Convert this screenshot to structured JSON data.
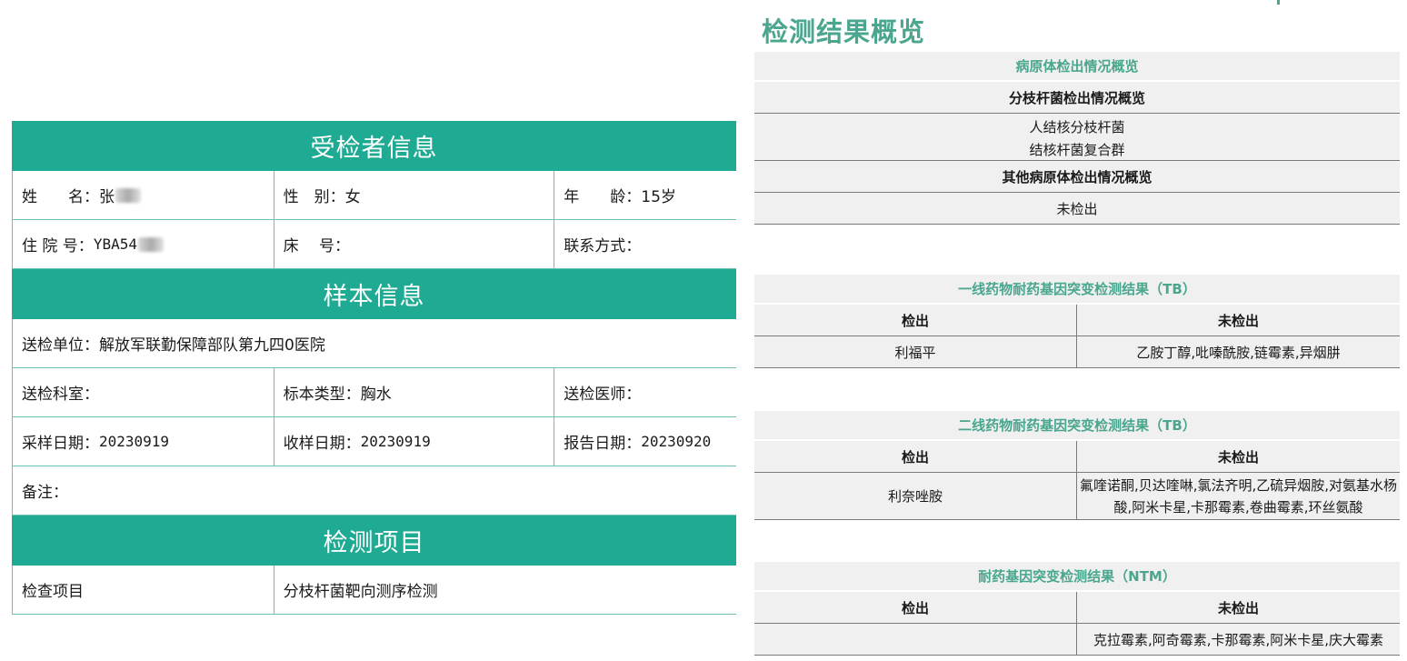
{
  "left": {
    "section_patient": "受检者信息",
    "name_label": "姓　　名：",
    "name_value": "张",
    "gender_label": "性　别：",
    "gender_value": "女",
    "age_label": "年　　龄：",
    "age_value": "15岁",
    "inpatient_label": "住 院 号：",
    "inpatient_value": "YBA54",
    "bed_label": "床　 号：",
    "contact_label": "联系方式：",
    "section_sample": "样本信息",
    "unit_label": "送检单位：",
    "unit_value": "解放军联勤保障部队第九四0医院",
    "dept_label": "送检科室：",
    "sample_type_label": "标本类型：",
    "sample_type_value": "胸水",
    "doctor_label": "送检医师：",
    "collect_label": "采样日期：",
    "collect_value": "20230919",
    "receive_label": "收样日期：",
    "receive_value": "20230919",
    "report_label": "报告日期：",
    "report_value": "20230920",
    "remark_label": "备注：",
    "section_test": "检测项目",
    "test_item_label": "检查项目",
    "test_item_value": "分枝杆菌靶向测序检测"
  },
  "right": {
    "title": "检测结果概览",
    "pathogen": {
      "header": "病原体检出情况概览",
      "myco_header": "分枝杆菌检出情况概览",
      "myco_items": [
        "人结核分枝杆菌",
        "结核杆菌复合群"
      ],
      "other_header": "其他病原体检出情况概览",
      "other_value": "未检出"
    },
    "first_line": {
      "header": "一线药物耐药基因突变检测结果（TB）",
      "col_detected": "检出",
      "col_not_detected": "未检出",
      "detected": "利福平",
      "not_detected": "乙胺丁醇,吡嗪酰胺,链霉素,异烟肼"
    },
    "second_line": {
      "header": "二线药物耐药基因突变检测结果（TB）",
      "col_detected": "检出",
      "col_not_detected": "未检出",
      "detected": "利奈唑胺",
      "not_detected_1": "氟喹诺酮,贝达喹啉,氯法齐明,乙硫异烟胺,对氨基水杨",
      "not_detected_2": "酸,阿米卡星,卡那霉素,卷曲霉素,环丝氨酸"
    },
    "ntm": {
      "header": "耐药基因突变检测结果（NTM）",
      "col_detected": "检出",
      "col_not_detected": "未检出",
      "detected": "",
      "not_detected": "克拉霉素,阿奇霉素,卡那霉素,阿米卡星,庆大霉素"
    }
  },
  "colors": {
    "band": "#1fab93",
    "accent_text": "#4aa68e",
    "table_bg": "#f0f0f0",
    "border": "#6cc1b2"
  }
}
